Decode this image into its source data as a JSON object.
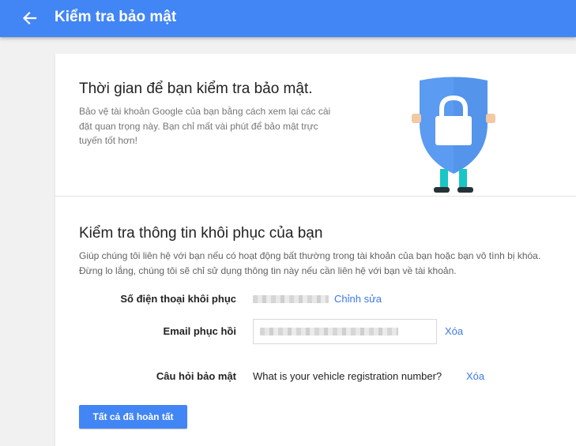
{
  "header": {
    "back_icon": "arrow-back-icon",
    "title": "Kiểm tra bảo mật"
  },
  "intro": {
    "title": "Thời gian để bạn kiểm tra bảo mật.",
    "description": "Bảo vệ tài khoản Google của bạn bằng cách xem lại các cài đặt quan trọng này. Bạn chỉ mất vài phút để bảo mật trực tuyến tốt hơn!",
    "illustration_icon": "shield-lock-icon"
  },
  "recovery": {
    "title": "Kiểm tra thông tin khôi phục của bạn",
    "description": "Giúp chúng tôi liên hệ với bạn nếu có hoạt động bất thường trong tài khoản của bạn hoặc bạn vô tình bị khóa. Đừng lo lắng, chúng tôi sẽ chỉ sử dụng thông tin này nếu cần liên hệ với bạn về tài khoản.",
    "phone": {
      "label": "Số điện thoại khôi phục",
      "action": "Chỉnh sửa"
    },
    "email": {
      "label": "Email phục hồi",
      "action": "Xóa"
    },
    "security_question": {
      "label": "Câu hỏi bảo mật",
      "value": "What is your vehicle registration number?",
      "action": "Xóa"
    }
  },
  "done_button": "Tất cả đã hoàn tất",
  "colors": {
    "header": "#4285f4",
    "link": "#3b78e7",
    "shield": "#5b9bf1",
    "button": "#4285f4"
  }
}
